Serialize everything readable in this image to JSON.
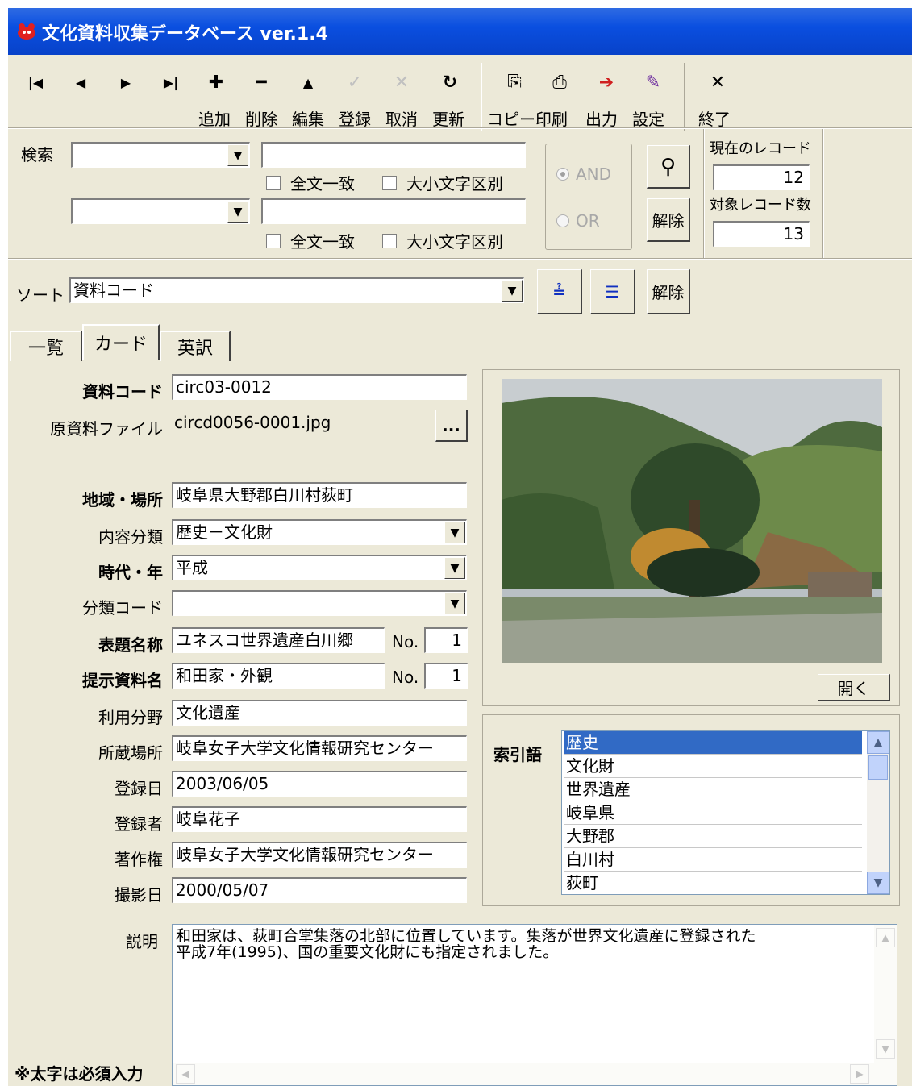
{
  "window": {
    "title": "文化資料収集データベース ver.1.4"
  },
  "toolbar": {
    "nav_first": "⏮",
    "nav_prev": "◄",
    "nav_next": "►",
    "nav_last": "⏭",
    "add": "追加",
    "delete": "削除",
    "edit": "編集",
    "register": "登録",
    "cancel": "取消",
    "refresh": "更新",
    "copy": "コピー",
    "print": "印刷",
    "output": "出力",
    "settings": "設定",
    "exit": "終了"
  },
  "search": {
    "label": "検索",
    "full_match_1": "全文一致",
    "case_1": "大小文字区別",
    "full_match_2": "全文一致",
    "case_2": "大小文字区別",
    "and_label": "AND",
    "or_label": "OR",
    "clear": "解除",
    "current_record_label": "現在のレコード",
    "current_record": "12",
    "target_count_label": "対象レコード数",
    "target_count": "13"
  },
  "sort": {
    "label": "ソート",
    "value": "資料コード",
    "clear": "解除"
  },
  "tabs": [
    "一覧",
    "カード",
    "英訳"
  ],
  "form": {
    "code_label": "資料コード",
    "code": "circ03-0012",
    "file_label": "原資料ファイル",
    "file": "circd0056-0001.jpg",
    "browse": "...",
    "place_label": "地域・場所",
    "place": "岐阜県大野郡白川村荻町",
    "content_label": "内容分類",
    "content": "歴史－文化財",
    "era_label": "時代・年",
    "era": "平成",
    "class_label": "分類コード",
    "class_code": "",
    "title_label": "表題名称",
    "title": "ユネスコ世界遺産白川郷",
    "title_no_label": "No.",
    "title_no": "1",
    "item_label": "提示資料名",
    "item": "和田家・外観",
    "item_no_label": "No.",
    "item_no": "1",
    "use_label": "利用分野",
    "use": "文化遺産",
    "storage_label": "所蔵場所",
    "storage": "岐阜女子大学文化情報研究センター",
    "reg_date_label": "登録日",
    "reg_date": "2003/06/05",
    "registrant_label": "登録者",
    "registrant": "岐阜花子",
    "copyright_label": "著作権",
    "copyright": "岐阜女子大学文化情報研究センター",
    "shot_date_label": "撮影日",
    "shot_date": "2000/05/07",
    "desc_label": "説明",
    "desc_line1": "和田家は、荻町合掌集落の北部に位置しています。集落が世界文化遺産に登録された",
    "desc_line2": "平成7年(1995)、国の重要文化財にも指定されました。",
    "required_note": "※太字は必須入力"
  },
  "image": {
    "open": "開く"
  },
  "index": {
    "label": "索引語",
    "items": [
      "歴史",
      "文化財",
      "世界遺産",
      "岐阜県",
      "大野郡",
      "白川村",
      "荻町"
    ]
  },
  "colors": {
    "titlebar": "#0a4fe0",
    "selection": "#316ac5",
    "face": "#ece9d8"
  }
}
